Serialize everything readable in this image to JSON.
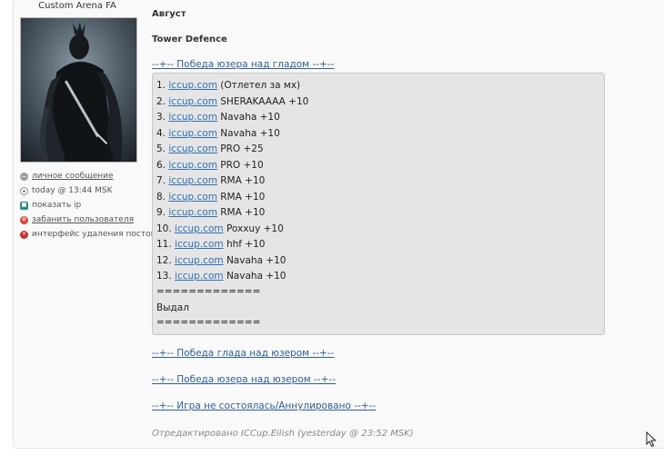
{
  "user": {
    "name": "Custom Arena FA",
    "actions": [
      {
        "label": "личное сообщение",
        "icon": "message-icon"
      },
      {
        "label": "today @ 13:44 MSK",
        "icon": "clock-icon"
      },
      {
        "label": "показать ip",
        "icon": "ip-icon"
      },
      {
        "label": "забанить пользователя",
        "icon": "ban-icon"
      },
      {
        "label": "интерфейс удаления постов",
        "icon": "delete-icon"
      }
    ]
  },
  "post": {
    "month": "Август",
    "mode": "Tower Defence",
    "section1": "--+-- Победа юзера над гладом --+--",
    "quote_lines": [
      {
        "num": "1.",
        "site": "iccup.com",
        "rest": "(Отлетел за мх)"
      },
      {
        "num": "2.",
        "site": "iccup.com",
        "rest": "SHERAKAAAA +10"
      },
      {
        "num": "3.",
        "site": "iccup.com",
        "rest": "Navaha +10"
      },
      {
        "num": "4.",
        "site": "iccup.com",
        "rest": "Navaha +10"
      },
      {
        "num": "5.",
        "site": "iccup.com",
        "rest": "PRO +25"
      },
      {
        "num": "6.",
        "site": "iccup.com",
        "rest": "PRO +10"
      },
      {
        "num": "7.",
        "site": "iccup.com",
        "rest": "RMA +10"
      },
      {
        "num": "8.",
        "site": "iccup.com",
        "rest": "RMA +10"
      },
      {
        "num": "9.",
        "site": "iccup.com",
        "rest": "RMA +10"
      },
      {
        "num": "10.",
        "site": "iccup.com",
        "rest": "Poxxuy +10"
      },
      {
        "num": "11.",
        "site": "iccup.com",
        "rest": "hhf +10"
      },
      {
        "num": "12.",
        "site": "iccup.com",
        "rest": "Navaha +10"
      },
      {
        "num": "13.",
        "site": "iccup.com",
        "rest": "Navaha +10"
      }
    ],
    "separator": "=============",
    "issued": "Выдал",
    "section2": "--+-- Победа глада над юзером --+--",
    "section3": "--+-- Победа юзера над юзером --+--",
    "section4": "--+-- Игра не состоялась/Аннулировано --+--",
    "edited": "Отредактировано ICCup.Eilish (yesterday @ 23:52 MSK)"
  }
}
